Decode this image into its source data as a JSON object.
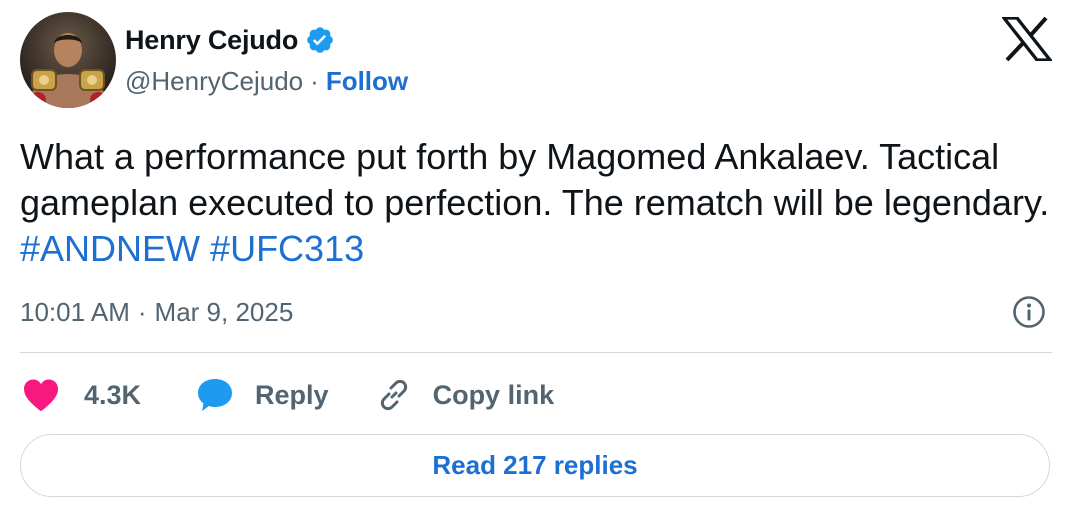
{
  "author": {
    "display_name": "Henry Cejudo",
    "handle": "@HenryCejudo",
    "separator": "·",
    "follow_label": "Follow",
    "avatar_icon": "avatar-photo",
    "verified_icon": "verified-badge-icon"
  },
  "brand": {
    "logo_icon": "x-logo-icon"
  },
  "tweet": {
    "text": "What a performance put forth by Magomed Ankalaev. Tactical gameplan executed to perfection. The rematch will be legendary. ",
    "hashtags": [
      "#ANDNEW",
      "#UFC313"
    ],
    "time": "10:01 AM",
    "separator": "·",
    "date": "Mar 9, 2025",
    "info_icon": "info-icon"
  },
  "actions": {
    "like_count": "4.3K",
    "reply_label": "Reply",
    "copy_label": "Copy link"
  },
  "read_replies_label": "Read 217 replies",
  "colors": {
    "text": "#0f1419",
    "secondary": "#536471",
    "link": "#1d6fd1",
    "heart": "#f91880",
    "reply_bubble": "#1d9bf0",
    "border": "#cfd9de"
  }
}
